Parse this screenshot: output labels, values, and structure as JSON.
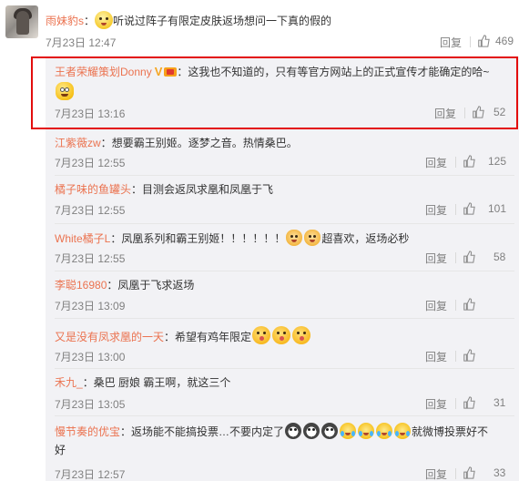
{
  "top_comment": {
    "user": "雨妹豹s",
    "colon": "：",
    "text": "听说过阵子有限定皮肤返场想问一下真的假的",
    "time": "7月23日 12:47",
    "reply": "回复",
    "likes": "469"
  },
  "highlighted_comment": {
    "user": "王者荣耀策划Donny",
    "colon": "：",
    "text": "这我也不知道的，只有等官方网站上的正式宣传才能确定的哈~",
    "time": "7月23日 13:16",
    "reply": "回复",
    "likes": "52"
  },
  "sub_comments": [
    {
      "user": "江紫薇zw",
      "colon": "：",
      "text": "想要霸王别姬。逐梦之音。热情桑巴。",
      "time": "7月23日 12:55",
      "reply": "回复",
      "likes": "125"
    },
    {
      "user": "橘子味的鱼罐头",
      "colon": "：",
      "text": "目测会返凤求凰和凤凰于飞",
      "time": "7月23日 12:55",
      "reply": "回复",
      "likes": "101"
    },
    {
      "user": "White橘子L",
      "colon": "：",
      "text": "凤凰系列和霸王别姬！！！！！！",
      "text_after": "超喜欢，返场必秒",
      "time": "7月23日 12:55",
      "reply": "回复",
      "likes": "58"
    },
    {
      "user": "李聪16980",
      "colon": "：",
      "text": "凤凰于飞求返场",
      "time": "7月23日 13:09",
      "reply": "回复",
      "likes": ""
    },
    {
      "user": "又是没有凤求凰的一天",
      "colon": "：",
      "text": "希望有鸡年限定",
      "time": "7月23日 13:00",
      "reply": "回复",
      "likes": ""
    },
    {
      "user": "禾九_",
      "colon": "：",
      "text": "桑巴 厨娘 霸王啊，就这三个",
      "time": "7月23日 13:05",
      "reply": "回复",
      "likes": "31"
    },
    {
      "user": "慢节奏的优宝",
      "colon": "：",
      "text": "返场能不能搞投票…不要内定了",
      "text_after": "就微博投票好不",
      "text_wrap": "好",
      "time": "7月23日 12:57",
      "reply": "回复",
      "likes": "33"
    }
  ],
  "colors": {
    "username": "#eb7350",
    "highlight_border": "#e30d0d",
    "sub_bg": "#f2f2f5",
    "meta": "#808080"
  }
}
